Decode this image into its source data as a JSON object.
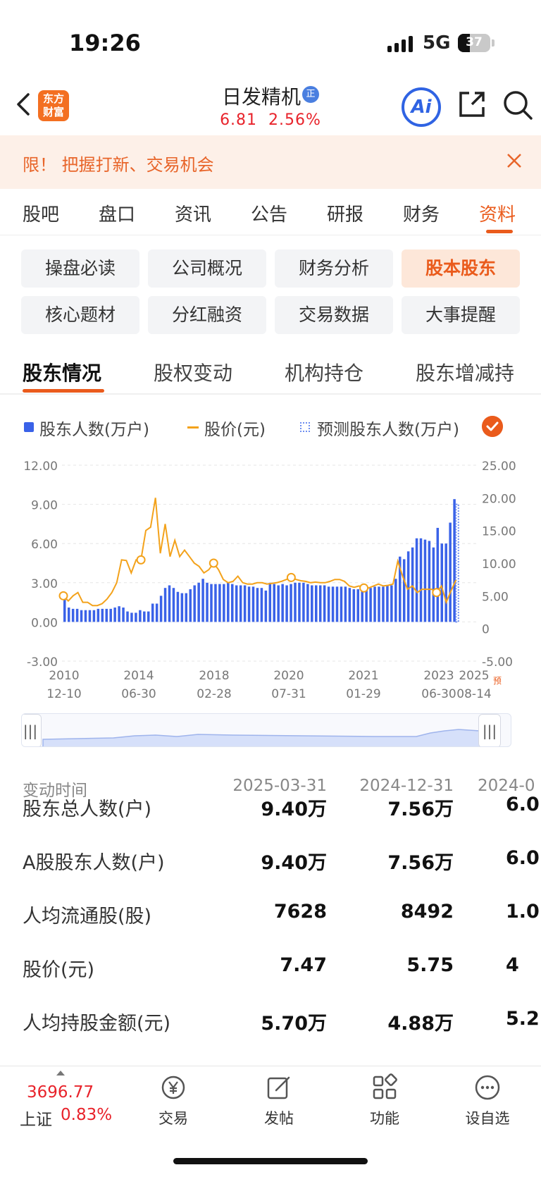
{
  "status": {
    "time": "19:26",
    "network": "5G",
    "battery": "37",
    "battery_level": 0.37
  },
  "header": {
    "stock_name": "日发精机",
    "badge": "正",
    "price": "6.81",
    "change_pct": "2.56%",
    "logo_line1": "东方",
    "logo_line2": "财富",
    "ai_label": "Ai"
  },
  "banner": {
    "text": "限！ 把握打新、交易机会"
  },
  "main_tabs": [
    {
      "label": "股吧"
    },
    {
      "label": "盘口"
    },
    {
      "label": "资讯"
    },
    {
      "label": "公告"
    },
    {
      "label": "研报"
    },
    {
      "label": "财务"
    },
    {
      "label": "资料",
      "active": true
    }
  ],
  "grid_buttons": [
    {
      "label": "操盘必读"
    },
    {
      "label": "公司概况"
    },
    {
      "label": "财务分析"
    },
    {
      "label": "股本股东",
      "active": true
    },
    {
      "label": "核心题材"
    },
    {
      "label": "分红融资"
    },
    {
      "label": "交易数据"
    },
    {
      "label": "大事提醒"
    }
  ],
  "sub_tabs": [
    {
      "label": "股东情况",
      "active": true
    },
    {
      "label": "股权变动"
    },
    {
      "label": "机构持仓"
    },
    {
      "label": "股东增减持"
    }
  ],
  "legend": {
    "holders": "股东人数(万户)",
    "price": "股价(元)",
    "forecast": "预测股东人数(万户)"
  },
  "chart_data": {
    "type": "bar",
    "series": [
      {
        "name": "股东人数(万户)",
        "type": "bar",
        "axis": "left",
        "values": [
          1.8,
          1.1,
          1.0,
          1.0,
          0.9,
          0.9,
          0.9,
          0.9,
          1.0,
          1.0,
          1.0,
          1.0,
          1.1,
          1.2,
          1.1,
          0.8,
          0.7,
          0.7,
          0.9,
          0.8,
          0.8,
          1.4,
          1.4,
          2.0,
          2.6,
          2.8,
          2.6,
          2.3,
          2.2,
          2.2,
          2.5,
          2.8,
          3.0,
          3.3,
          3.0,
          2.9,
          2.9,
          2.9,
          2.9,
          3.0,
          2.9,
          2.8,
          2.8,
          2.8,
          2.7,
          2.7,
          2.6,
          2.6,
          2.4,
          3.0,
          2.9,
          2.8,
          2.9,
          2.8,
          2.9,
          3.0,
          3.0,
          3.0,
          2.9,
          2.8,
          2.8,
          2.8,
          2.8,
          2.7,
          2.7,
          2.7,
          2.7,
          2.7,
          2.6,
          2.5,
          2.5,
          2.5,
          2.6,
          2.6,
          2.7,
          2.7,
          2.7,
          2.8,
          2.8,
          3.3,
          5.0,
          4.8,
          5.4,
          5.7,
          6.4,
          6.4,
          6.3,
          6.2,
          5.7,
          7.2,
          6.0,
          6.0,
          7.6,
          9.4
        ]
      },
      {
        "name": "股价(元)",
        "type": "line",
        "axis": "right",
        "values": [
          5.0,
          4.2,
          5.0,
          5.5,
          4.0,
          4.0,
          3.5,
          3.5,
          3.8,
          4.5,
          5.5,
          7.0,
          10.5,
          10.4,
          8.5,
          10.5,
          10.5,
          15.0,
          15.5,
          20.0,
          11.5,
          16.0,
          11.0,
          13.5,
          11.0,
          12.0,
          11.0,
          10.0,
          9.5,
          8.5,
          9.0,
          10.0,
          9.0,
          7.5,
          7.0,
          7.2,
          8.0,
          7.0,
          6.8,
          6.8,
          7.0,
          7.0,
          6.8,
          6.9,
          7.0,
          7.2,
          7.5,
          7.8,
          7.5,
          7.3,
          7.2,
          7.0,
          7.1,
          7.0,
          7.0,
          7.2,
          7.5,
          7.5,
          7.2,
          6.5,
          6.3,
          6.5,
          6.2,
          6.2,
          6.5,
          6.8,
          6.5,
          6.6,
          6.8,
          10.3,
          8.0,
          6.0,
          6.5,
          5.5,
          6.0,
          6.0,
          6.0,
          5.5,
          6.5,
          4.0,
          5.8,
          7.4
        ]
      },
      {
        "name": "预测股东人数(万户)",
        "type": "dashed-bar",
        "axis": "left",
        "values": [
          9.0
        ]
      }
    ],
    "x_ticks": [
      {
        "year": "2010",
        "date": "12-10"
      },
      {
        "year": "2014",
        "date": "06-30"
      },
      {
        "year": "2018",
        "date": "02-28"
      },
      {
        "year": "2020",
        "date": "07-31"
      },
      {
        "year": "2021",
        "date": "01-29"
      },
      {
        "year": "2023",
        "date": "06-30"
      },
      {
        "year": "2025",
        "date": "08-14"
      }
    ],
    "forecast_mark": "预",
    "y_left": {
      "ticks": [
        "12.00",
        "9.00",
        "6.00",
        "3.00",
        "0.00",
        "-3.00"
      ],
      "ylim": [
        -3,
        12
      ]
    },
    "y_right": {
      "ticks": [
        "25.00",
        "20.00",
        "15.00",
        "10.00",
        "5.00",
        "0",
        "-5.00"
      ],
      "ylim": [
        -5,
        25
      ]
    },
    "grid": true
  },
  "table": {
    "header_label": "变动时间",
    "dates": [
      "2025-03-31",
      "2024-12-31",
      "2024-0"
    ],
    "rows": [
      {
        "label": "股东总人数(户)",
        "values": [
          "9.40万",
          "7.56万",
          "6.0"
        ]
      },
      {
        "label": "A股股东人数(户)",
        "values": [
          "9.40万",
          "7.56万",
          "6.0"
        ]
      },
      {
        "label": "人均流通股(股)",
        "values": [
          "7628",
          "8492",
          "1.0"
        ]
      },
      {
        "label": "股价(元)",
        "values": [
          "7.47",
          "5.75",
          "4"
        ]
      },
      {
        "label": "人均持股金额(元)",
        "values": [
          "5.70万",
          "4.88万",
          "5.2"
        ]
      }
    ]
  },
  "bottom": {
    "index_value": "3696.77",
    "index_name": "上证",
    "index_change": "0.83%",
    "nav": [
      {
        "label": "交易"
      },
      {
        "label": "发帖"
      },
      {
        "label": "功能"
      },
      {
        "label": "设自选"
      }
    ]
  }
}
